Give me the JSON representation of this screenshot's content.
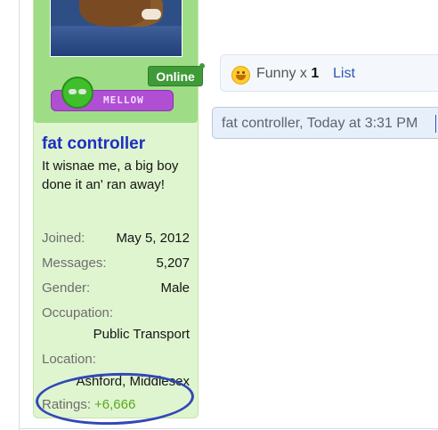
{
  "user": {
    "status": "Online",
    "mood": "MELLOW",
    "name": "fat controller",
    "title": "It wisnae me, a big boy done it an' ran away!",
    "info": {
      "joined_label": "Joined:",
      "joined_value": "May 5, 2012",
      "messages_label": "Messages:",
      "messages_value": "5,207",
      "gender_label": "Gender:",
      "gender_value": "Male",
      "occupation_label": "Occupation:",
      "occupation_value": "Public Transport",
      "location_label": "Location:",
      "location_value": "Ashford, Middlesex",
      "ratings_label": "Ratings:",
      "ratings_value": "+6,666"
    }
  },
  "ratings_bar": {
    "icon": "funny-face-icon",
    "label": "Funny x ",
    "count": "1",
    "list_link": "List"
  },
  "post_meta": {
    "text": "fat controller, Today at 3:31 PM"
  },
  "colors": {
    "panel_bg": "#dff5cf",
    "online_badge": "#3f9b37",
    "username": "#1d2fc1",
    "ratings_value": "#58a81e",
    "annotation_circle": "#3347b8",
    "link": "#2f54b8"
  }
}
